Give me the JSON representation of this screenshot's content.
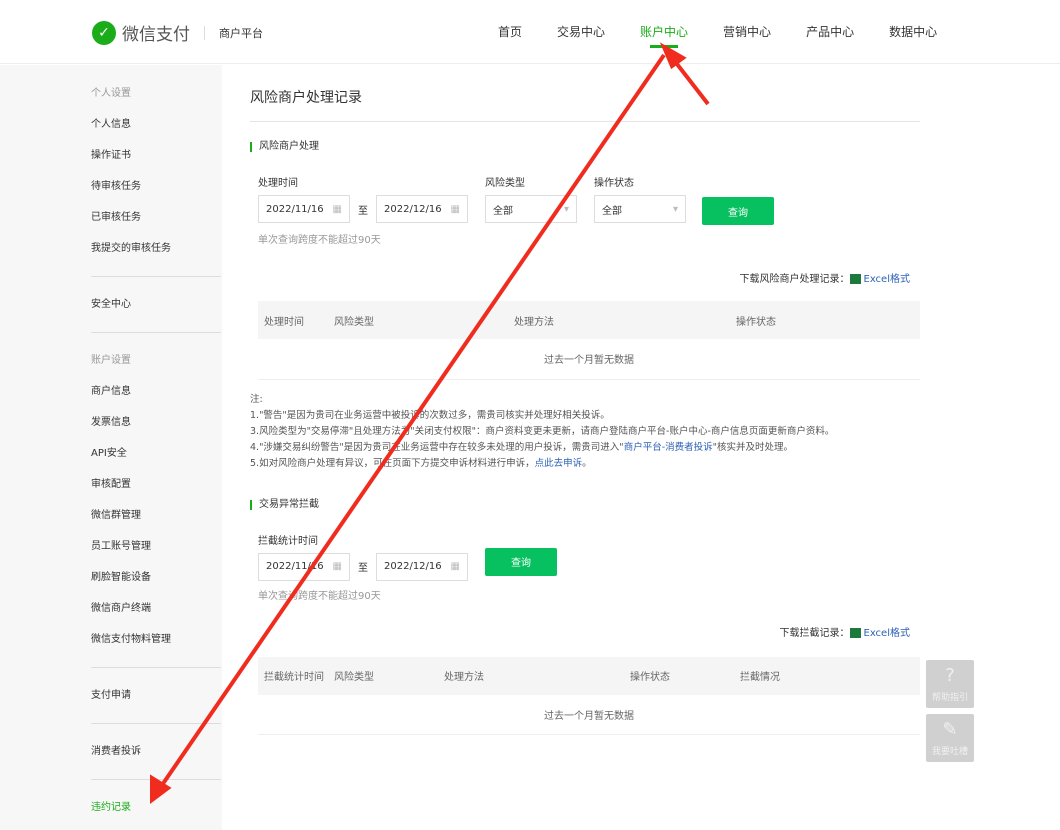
{
  "header": {
    "logo": "微信支付",
    "sub": "商户平台",
    "nav": [
      "首页",
      "交易中心",
      "账户中心",
      "营销中心",
      "产品中心",
      "数据中心"
    ]
  },
  "sidebar": {
    "g1_title": "个人设置",
    "g1": [
      "个人信息",
      "操作证书",
      "待审核任务",
      "已审核任务",
      "我提交的审核任务"
    ],
    "g2": [
      "安全中心"
    ],
    "g3_title": "账户设置",
    "g3": [
      "商户信息",
      "发票信息",
      "API安全",
      "审核配置",
      "微信群管理",
      "员工账号管理",
      "刷脸智能设备",
      "微信商户终端",
      "微信支付物料管理"
    ],
    "g4": [
      "支付申请"
    ],
    "g5": [
      "消费者投诉"
    ],
    "g6": [
      "违约记录"
    ]
  },
  "main": {
    "title": "风险商户处理记录",
    "s1": {
      "title": "风险商户处理",
      "time_label": "处理时间",
      "start": "2022/11/16",
      "to": "至",
      "end": "2022/12/16",
      "type_label": "风险类型",
      "type_value": "全部",
      "status_label": "操作状态",
      "status_value": "全部",
      "query": "查询",
      "hint": "单次查询跨度不能超过90天",
      "download": "下载风险商户处理记录：",
      "excel": "Excel格式",
      "columns": [
        "处理时间",
        "风险类型",
        "处理方法",
        "操作状态"
      ],
      "empty": "过去一个月暂无数据"
    },
    "notes": {
      "title": "注:",
      "n1": "1.\"警告\"是因为贵司在业务运营中被投诉的次数过多，需贵司核实并处理好相关投诉。",
      "n3": "3.风险类型为\"交易停滞\"且处理方法为\"关闭支付权限\"：商户资料变更未更新，请商户登陆商户平台-账户中心-商户信息页面更新商户资料。",
      "n4a": "4.\"涉嫌交易纠纷警告\"是因为贵司在业务运营中存在较多未处理的用户投诉，需贵司进入\"",
      "n4link": "商户平台-消费者投诉",
      "n4b": "\"核实并及时处理。",
      "n5a": "5.如对风险商户处理有异议，可在页面下方提交申诉材料进行申诉，",
      "n5link": "点此去申诉",
      "n5b": "。"
    },
    "s2": {
      "title": "交易异常拦截",
      "time_label": "拦截统计时间",
      "start": "2022/11/16",
      "to": "至",
      "end": "2022/12/16",
      "query": "查询",
      "hint": "单次查询跨度不能超过90天",
      "download": "下载拦截记录：",
      "excel": "Excel格式",
      "columns": [
        "拦截统计时间",
        "风险类型",
        "处理方法",
        "操作状态",
        "拦截情况"
      ],
      "empty": "过去一个月暂无数据"
    }
  },
  "float": {
    "help": "帮助指引",
    "feedback": "我要吐槽"
  },
  "colors": {
    "accent": "#1aad19",
    "arrow": "#f02c1f"
  }
}
